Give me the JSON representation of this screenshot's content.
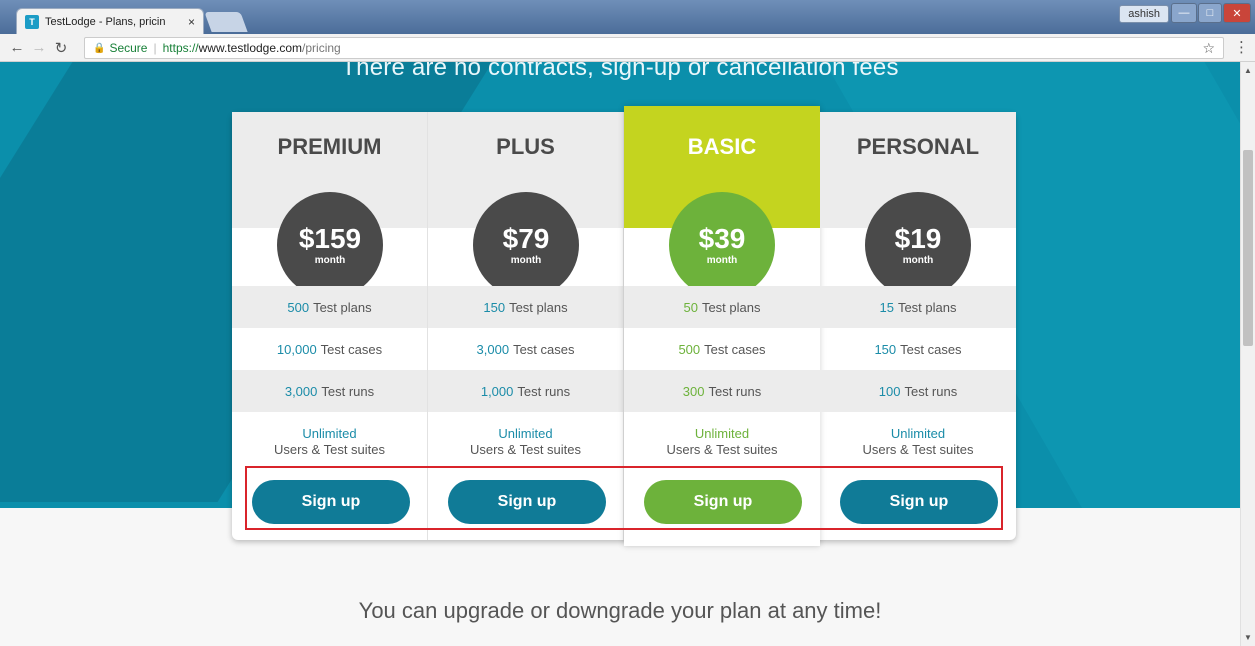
{
  "browser": {
    "tab_title": "TestLodge - Plans, pricin",
    "tab_close": "×",
    "user_name": "ashish",
    "address": {
      "secure_label": "Secure",
      "scheme": "https://",
      "host": "www.testlodge.com",
      "path": "/pricing"
    }
  },
  "page": {
    "tagline": "There are no contracts, sign-up or cancellation fees",
    "upgrade_text": "You can upgrade or downgrade your plan at any time!"
  },
  "plans": [
    {
      "name": "PREMIUM",
      "price": "$159",
      "period": "month",
      "test_plans": {
        "num": "500",
        "label": "Test plans"
      },
      "test_cases": {
        "num": "10,000",
        "label": "Test cases"
      },
      "test_runs": {
        "num": "3,000",
        "label": "Test runs"
      },
      "unlimited": "Unlimited",
      "unlimited_desc": "Users & Test suites",
      "signup": "Sign up"
    },
    {
      "name": "PLUS",
      "price": "$79",
      "period": "month",
      "test_plans": {
        "num": "150",
        "label": "Test plans"
      },
      "test_cases": {
        "num": "3,000",
        "label": "Test cases"
      },
      "test_runs": {
        "num": "1,000",
        "label": "Test runs"
      },
      "unlimited": "Unlimited",
      "unlimited_desc": "Users & Test suites",
      "signup": "Sign up"
    },
    {
      "name": "BASIC",
      "price": "$39",
      "period": "month",
      "test_plans": {
        "num": "50",
        "label": "Test plans"
      },
      "test_cases": {
        "num": "500",
        "label": "Test cases"
      },
      "test_runs": {
        "num": "300",
        "label": "Test runs"
      },
      "unlimited": "Unlimited",
      "unlimited_desc": "Users & Test suites",
      "signup": "Sign up"
    },
    {
      "name": "PERSONAL",
      "price": "$19",
      "period": "month",
      "test_plans": {
        "num": "15",
        "label": "Test plans"
      },
      "test_cases": {
        "num": "150",
        "label": "Test cases"
      },
      "test_runs": {
        "num": "100",
        "label": "Test runs"
      },
      "unlimited": "Unlimited",
      "unlimited_desc": "Users & Test suites",
      "signup": "Sign up"
    }
  ],
  "colors": {
    "hero_bg": "#0b8fab",
    "featured_header": "#c4d41f",
    "featured_accent": "#6db23b",
    "button_blue": "#107b97",
    "highlight_box": "#d9242b"
  }
}
